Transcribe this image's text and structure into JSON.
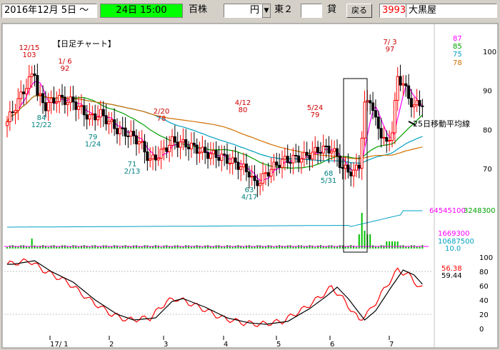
{
  "toolbar": {
    "date_range": "2016年12月 5日 ～",
    "time_box": "24日 15:00",
    "unit_label": "百株",
    "price_unit": "円",
    "dropdown_glyph": "▼",
    "market": "東２",
    "lend_label": "貸",
    "back_button": "戻る",
    "code": "3993",
    "company": "大黒屋"
  },
  "chart_data": {
    "type": "candlestick",
    "title": "【日足チャート】",
    "annotation_ma": "25日移動平均線",
    "price_axis": {
      "ticks": [
        70,
        80,
        90,
        100
      ],
      "range": [
        62,
        104
      ]
    },
    "indicator_axis": {
      "ticks": [
        0,
        20,
        40,
        60,
        80,
        100
      ],
      "range": [
        0,
        100
      ]
    },
    "x_labels": [
      "17/ 1",
      "2",
      "3",
      "4",
      "5",
      "6",
      "7"
    ],
    "ma_values": {
      "short": "87",
      "mid": "85",
      "mid2": "75",
      "long": "78"
    },
    "volume_values": {
      "a": "64545100",
      "b": "3248300",
      "c": "1669300",
      "d": "10687500",
      "e": "10.0"
    },
    "oscillator_values": {
      "k": "56.38",
      "d": "59.44"
    },
    "callouts": [
      {
        "date": "12/15",
        "price": "103",
        "pos": "above"
      },
      {
        "date": "1/ 6",
        "price": "92",
        "pos": "above"
      },
      {
        "date": "12/22",
        "price": "84",
        "pos": "below"
      },
      {
        "date": "1/24",
        "price": "79",
        "pos": "below"
      },
      {
        "date": "2/13",
        "price": "71",
        "pos": "below"
      },
      {
        "date": "2/20",
        "price": "78",
        "pos": "above"
      },
      {
        "date": "4/12",
        "price": "80",
        "pos": "above"
      },
      {
        "date": "4/17",
        "price": "63",
        "pos": "below"
      },
      {
        "date": "5/24",
        "price": "79",
        "pos": "above"
      },
      {
        "date": "5/31",
        "price": "68",
        "pos": "below"
      },
      {
        "date": "7/ 3",
        "price": "97",
        "pos": "above"
      }
    ],
    "colors": {
      "up": "#ff0000",
      "down": "#000000",
      "ma_short": "#ff00ff",
      "ma_mid": "#00a000",
      "ma_mid2": "#00a0c0",
      "ma_long": "#d07000",
      "volume": "#00c000",
      "osc_k": "#ff0000",
      "osc_d": "#000000"
    }
  }
}
